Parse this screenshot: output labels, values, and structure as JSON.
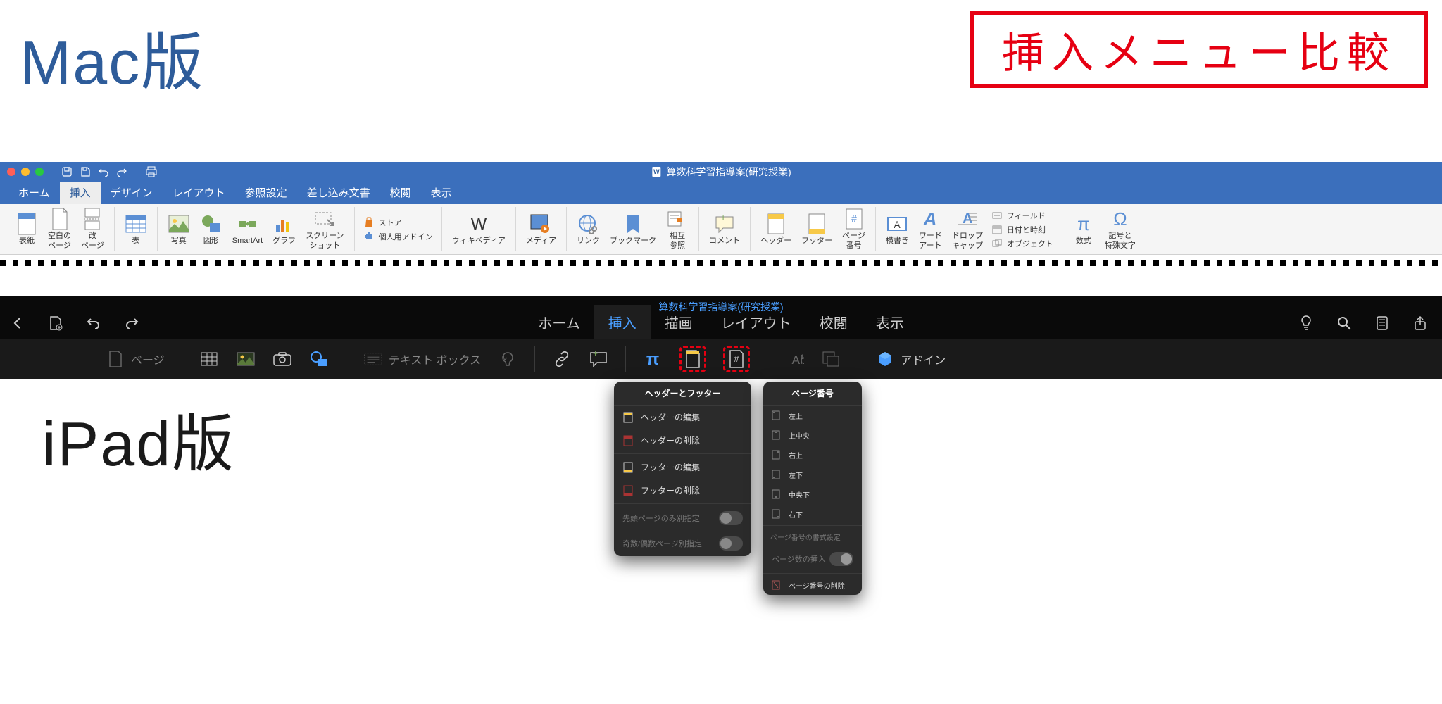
{
  "titles": {
    "mac_version": "Mac版",
    "ipad_version": "iPad版",
    "compare": "挿入メニュー比較"
  },
  "mac": {
    "document": "算数科学習指導案(研究授業)",
    "tabs": [
      "ホーム",
      "挿入",
      "デザイン",
      "レイアウト",
      "参照設定",
      "差し込み文書",
      "校閲",
      "表示"
    ],
    "active_tab": "挿入",
    "ribbon": {
      "cover": "表紙",
      "blank_page": "空白の\nページ",
      "page_break": "改\nページ",
      "table": "表",
      "picture": "写真",
      "shapes": "図形",
      "smartart": "SmartArt",
      "chart": "グラフ",
      "screenshot": "スクリーン\nショット",
      "store": "ストア",
      "myaddins": "個人用アドイン",
      "wikipedia": "ウィキペディア",
      "media": "メディア",
      "link": "リンク",
      "bookmark": "ブックマーク",
      "crossref": "相互\n参照",
      "comment": "コメント",
      "header": "ヘッダー",
      "footer": "フッター",
      "pagenum": "ページ\n番号",
      "textbox_h": "横書き",
      "wordart": "ワード\nアート",
      "dropcap": "ドロップ\nキャップ",
      "field": "フィールド",
      "datetime": "日付と時刻",
      "object": "オブジェクト",
      "equation": "数式",
      "symbol": "記号と\n特殊文字"
    }
  },
  "ipad": {
    "document": "算数科学習指導案(研究授業)",
    "tabs": [
      "ホーム",
      "挿入",
      "描画",
      "レイアウト",
      "校閲",
      "表示"
    ],
    "active_tab": "挿入",
    "ribbon": {
      "page": "ページ",
      "textbox": "テキスト ボックス",
      "addins": "アドイン"
    },
    "popup_header_footer": {
      "title": "ヘッダーとフッター",
      "items": [
        "ヘッダーの編集",
        "ヘッダーの削除",
        "フッターの編集",
        "フッターの削除"
      ],
      "toggles": [
        "先頭ページのみ別指定",
        "奇数/偶数ページ別指定"
      ]
    },
    "popup_pagenum": {
      "title": "ページ番号",
      "positions": [
        "左上",
        "上中央",
        "右上",
        "左下",
        "中央下",
        "右下"
      ],
      "format": "ページ番号の書式設定",
      "insert_count": "ページ数の挿入",
      "remove": "ページ番号の削除"
    }
  }
}
